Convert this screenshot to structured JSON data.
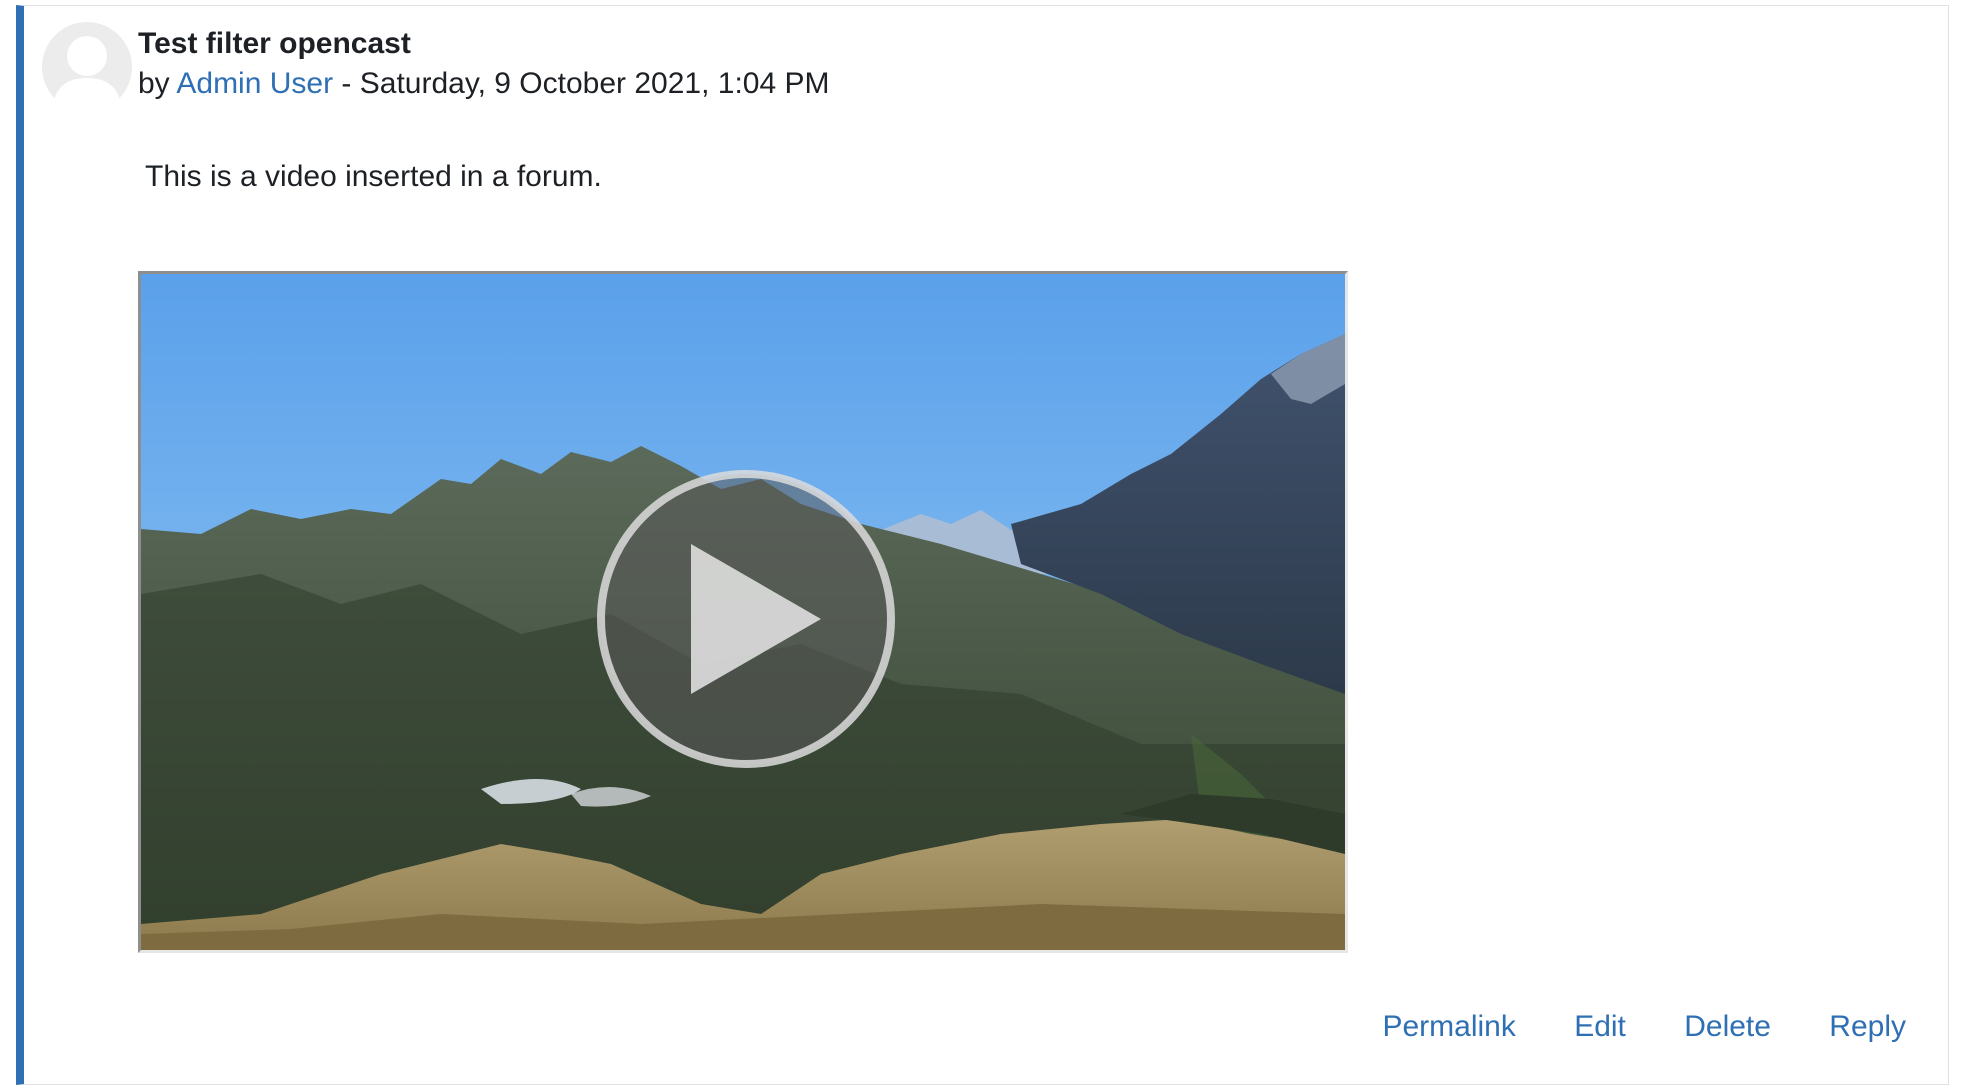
{
  "post": {
    "title": "Test filter opencast",
    "by_prefix": "by",
    "author": "Admin User",
    "date_separator": " - ",
    "date": "Saturday, 9 October 2021, 1:04 PM",
    "message": "This is a video inserted in a forum."
  },
  "video": {
    "thumbnail": "mountain-landscape",
    "play_icon": "play-icon"
  },
  "actions": {
    "permalink": "Permalink",
    "edit": "Edit",
    "delete": "Delete",
    "reply": "Reply"
  },
  "colors": {
    "accent": "#2f6fb3",
    "text": "#1d2125",
    "border": "#dee2e6"
  }
}
